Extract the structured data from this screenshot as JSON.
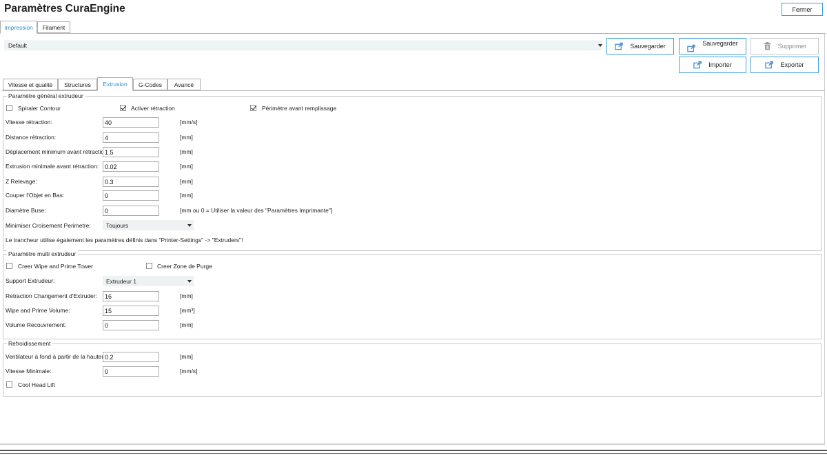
{
  "window": {
    "title": "Paramètres CuraEngine",
    "close_label": "Fermer"
  },
  "main_tabs": [
    {
      "label": "Impression"
    },
    {
      "label": "Filament"
    }
  ],
  "profile": {
    "selected": "Default"
  },
  "toolbar": {
    "save_label": "Sauvegarder",
    "save_as_label": "Sauvegarder",
    "delete_label": "Supprimer",
    "import_label": "Importer",
    "export_label": "Exporter"
  },
  "sub_tabs": [
    {
      "label": "Vitesse et qualité"
    },
    {
      "label": "Structures"
    },
    {
      "label": "Extrusion"
    },
    {
      "label": "G-Codes"
    },
    {
      "label": "Avancé"
    }
  ],
  "general": {
    "legend": "Paramètre général extrudeur",
    "spiral_label": "Spiraler Contour",
    "retraction_label": "Activer rétraction",
    "perimeter_first_label": "Périmètre avant remplissage",
    "rows": [
      {
        "label": "Vitesse rétraction:",
        "value": "40",
        "unit": "[mm/s]"
      },
      {
        "label": "Distance rétraction:",
        "value": "4",
        "unit": "[mm]"
      },
      {
        "label": "Déplacement minimum avant rétraction:",
        "value": "1.5",
        "unit": "[mm]"
      },
      {
        "label": "Extrusion minimale avant rétraction:",
        "value": "0.02",
        "unit": "[mm]"
      },
      {
        "label": "Z Relevage:",
        "value": "0.3",
        "unit": "[mm]"
      },
      {
        "label": "Couper l'Objet en Bas:",
        "value": "0",
        "unit": "[mm]"
      },
      {
        "label": "Diamètre Buse:",
        "value": "0",
        "unit": "[mm ou 0 = Utiliser la valeur des \"Paramètres Imprimante\"]"
      }
    ],
    "combing_label": "Minimiser Croisement Perimetre:",
    "combing_value": "Toujours",
    "note": "Le trancheur utilise également les paramètres définis dans \"Printer-Settings\" -> \"Extruders\"!"
  },
  "multi": {
    "legend": "Paramètre multi extrudeur",
    "wipe_tower_label": "Creer Wipe and Prime Tower",
    "purge_zone_label": "Creer Zone de Purge",
    "support_label": "Support Extrudeur:",
    "support_value": "Extrudeur 1",
    "rows": [
      {
        "label": "Retraction Changement d'Extruder:",
        "value": "16",
        "unit": "[mm]"
      },
      {
        "label": "Wipe and Prime Volume:",
        "value": "15",
        "unit": "[mm³]"
      },
      {
        "label": "Volume Recouvrement:",
        "value": "0",
        "unit": "[mm]"
      }
    ]
  },
  "cooling": {
    "legend": "Refroidissement",
    "rows": [
      {
        "label": "Ventilateur à fond à partir de la hauteur:",
        "value": "0.2",
        "unit": "[mm]"
      },
      {
        "label": "Vitesse Minimale:",
        "value": "0",
        "unit": "[mm/s]"
      }
    ],
    "cool_head_lift_label": "Cool Head Lift"
  }
}
